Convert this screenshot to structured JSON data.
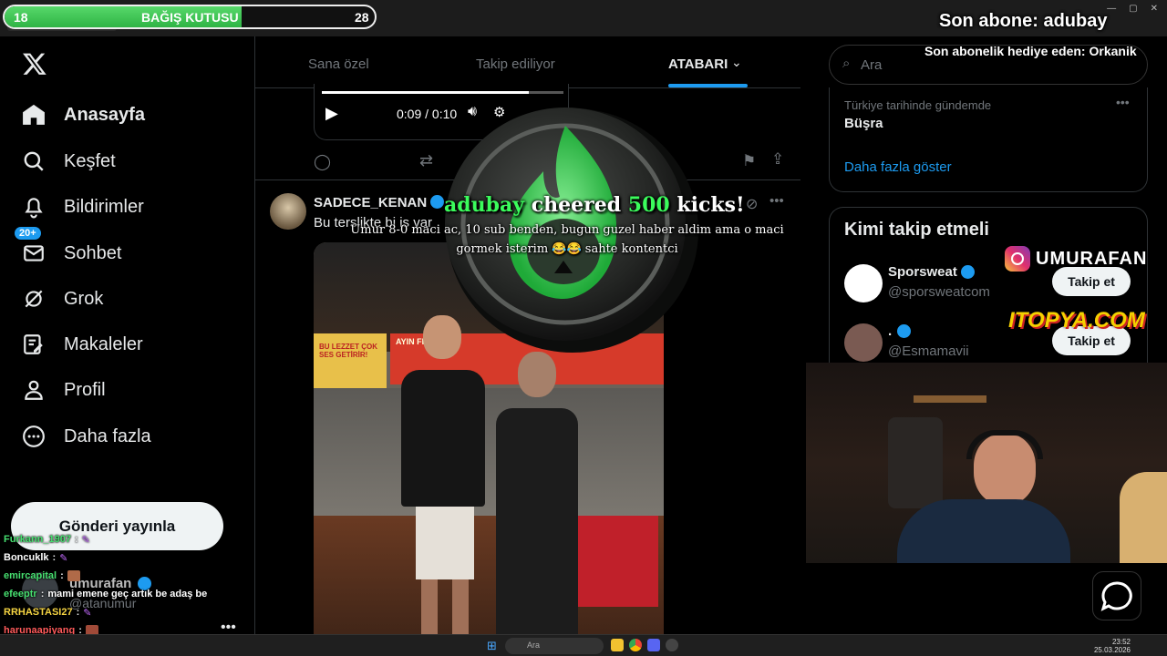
{
  "donation": {
    "label": "BAĞIŞ KUTUSU",
    "current": "18",
    "goal": "28",
    "progress": 0.64
  },
  "overlay": {
    "last_sub": "Son abone: adubay",
    "gift_sub": "Son abonelik hediye eden: Orkanik",
    "alert": {
      "user": "adubay",
      "cheered": "cheered",
      "amount": "500",
      "unit": "kicks!",
      "message": "Umur 8-0 maci ac, 10 sub benden, bugun guzel haber aldim ama o maci gormek isterim 😂😂 sahte kontentci"
    },
    "instagram": "UMURAFAN",
    "sponsor": "ITOPYA.COM"
  },
  "sidebar": {
    "badge": "20+",
    "items": [
      {
        "label": "Anasayfa",
        "icon": "home-icon"
      },
      {
        "label": "Keşfet",
        "icon": "search-icon"
      },
      {
        "label": "Bildirimler",
        "icon": "bell-icon"
      },
      {
        "label": "Sohbet",
        "icon": "mail-icon"
      },
      {
        "label": "Grok",
        "icon": "grok-icon"
      },
      {
        "label": "Makaleler",
        "icon": "articles-icon"
      },
      {
        "label": "Profil",
        "icon": "person-icon"
      },
      {
        "label": "Daha fazla",
        "icon": "more-icon"
      }
    ],
    "post_button": "Gönderi yayınla",
    "account_name": "umurafan",
    "account_handle": "@atanumur"
  },
  "chat": [
    {
      "user": "Furkann_1907",
      "msg": "",
      "color": "#47e070"
    },
    {
      "user": "Boncuklk",
      "msg": "",
      "color": "#ffffff"
    },
    {
      "user": "emircapital",
      "msg": "",
      "color": "#47e070"
    },
    {
      "user": "efeeptr",
      "msg": "mami emene geç artık be adaş be",
      "color": "#47e070"
    },
    {
      "user": "RRHASTASI27",
      "msg": "",
      "color": "#f5d442"
    },
    {
      "user": "harunaapiyang",
      "msg": "",
      "color": "#ff5a5a"
    },
    {
      "user": "tahakrkyy",
      "msg": "",
      "color": "#ffffff"
    }
  ],
  "main": {
    "tabs": [
      "Sana özel",
      "Takip ediliyor",
      "ATABARI"
    ],
    "player_time": "0:09 / 0:10",
    "tweet": {
      "author": "SADECE_KENAN",
      "text": "Bu terslikte bi is var"
    },
    "photo_signs": {
      "left": "BU LEZZET ÇOK SES GETİRİR!",
      "top": "AYIN FIRSATI"
    },
    "status_url": "2036894671775928730/photo/1"
  },
  "right": {
    "search_placeholder": "Ara",
    "trend_context": "Türkiye tarihinde gündemde",
    "trend_name": "Büşra",
    "show_more": "Daha fazla göster",
    "who_to_follow": "Kimi takip etmeli",
    "follow": [
      {
        "name": "Sporsweat",
        "handle": "@sporsweatcom",
        "button": "Takip et"
      },
      {
        "name": ".",
        "handle": "@Esmamavii",
        "button": "Takip et"
      }
    ]
  },
  "taskbar": {
    "search": "Ara",
    "time": "23:52",
    "date": "25.03.2026"
  }
}
